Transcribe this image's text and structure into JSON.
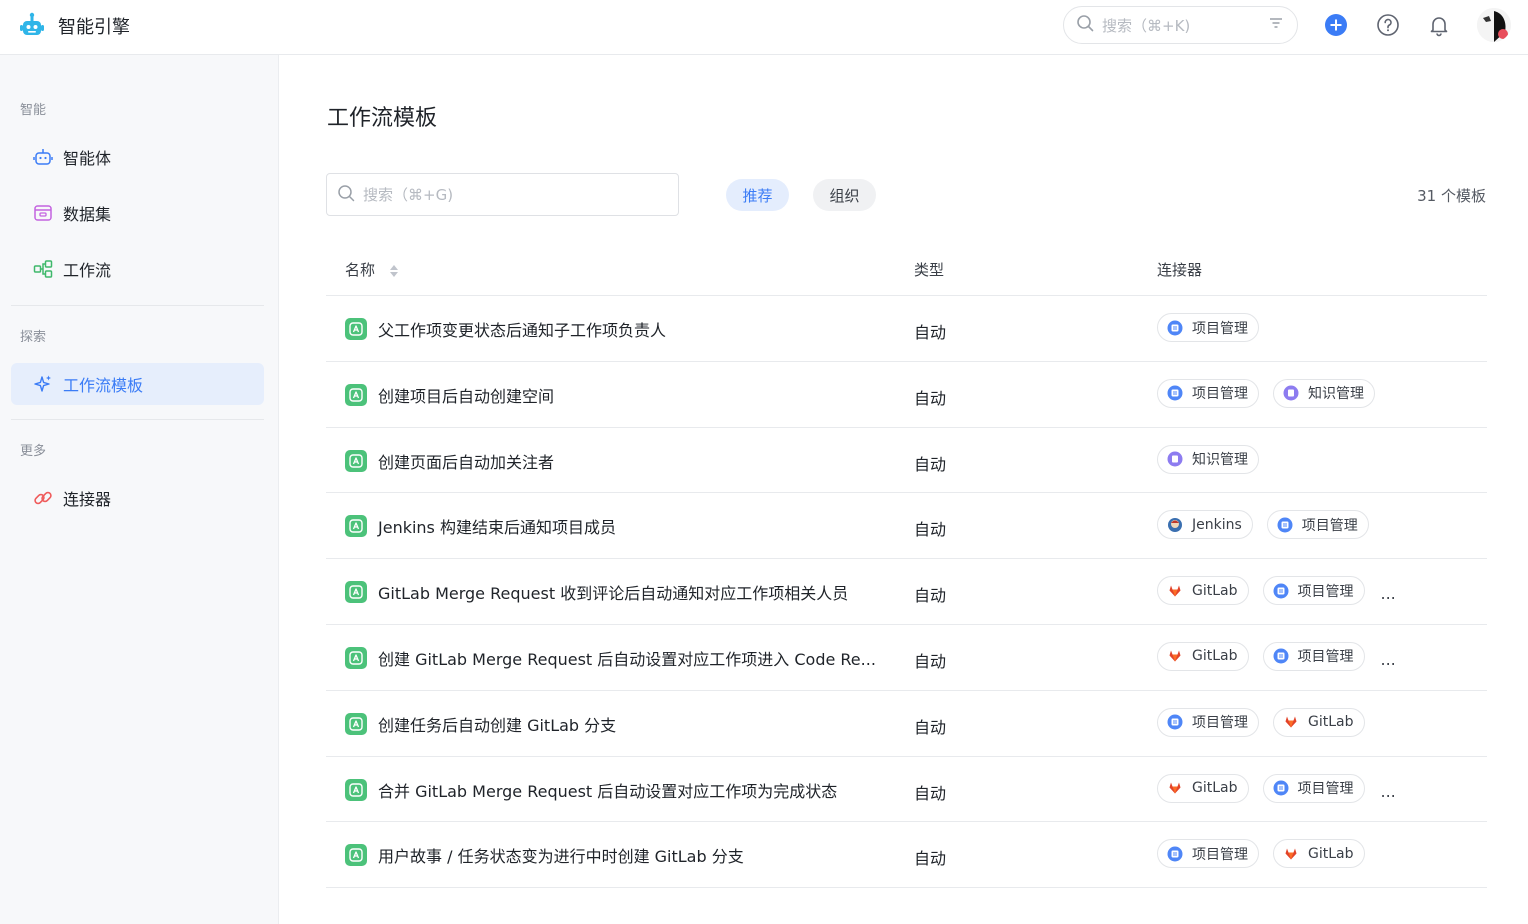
{
  "app": {
    "title": "智能引擎"
  },
  "topbar": {
    "search_placeholder": "搜索（⌘+K)",
    "icons": [
      "filter-icon",
      "plus-circle-icon",
      "help-icon",
      "bell-icon"
    ],
    "accent": "#3b7cf6"
  },
  "sidebar": {
    "sections": [
      {
        "label": "智能",
        "items": [
          {
            "label": "智能体",
            "icon": "robot-icon"
          },
          {
            "label": "数据集",
            "icon": "dataset-icon"
          },
          {
            "label": "工作流",
            "icon": "workflow-icon"
          }
        ]
      },
      {
        "label": "探索",
        "items": [
          {
            "label": "工作流模板",
            "icon": "sparkle-icon",
            "active": true
          }
        ]
      },
      {
        "label": "更多",
        "items": [
          {
            "label": "连接器",
            "icon": "link-icon"
          }
        ]
      }
    ]
  },
  "main": {
    "title": "工作流模板",
    "search_placeholder": "搜索（⌘+G)",
    "filters": [
      {
        "label": "推荐",
        "active": true
      },
      {
        "label": "组织",
        "active": false
      }
    ],
    "count_text": "31 个模板",
    "columns": {
      "name": "名称",
      "type": "类型",
      "connectors": "连接器"
    },
    "rows": [
      {
        "name": "父工作项变更状态后通知子工作项负责人",
        "type": "自动",
        "connectors": [
          "项目管理"
        ],
        "more": ""
      },
      {
        "name": "创建项目后自动创建空间",
        "type": "自动",
        "connectors": [
          "项目管理",
          "知识管理"
        ],
        "more": ""
      },
      {
        "name": "创建页面后自动加关注者",
        "type": "自动",
        "connectors": [
          "知识管理"
        ],
        "more": ""
      },
      {
        "name": "Jenkins 构建结束后通知项目成员",
        "type": "自动",
        "connectors": [
          "Jenkins",
          "项目管理"
        ],
        "more": ""
      },
      {
        "name": "GitLab Merge Request 收到评论后自动通知对应工作项相关人员",
        "type": "自动",
        "connectors": [
          "GitLab",
          "项目管理"
        ],
        "more": "..."
      },
      {
        "name": "创建 GitLab Merge Request 后自动设置对应工作项进入 Code Re...",
        "type": "自动",
        "connectors": [
          "GitLab",
          "项目管理"
        ],
        "more": "..."
      },
      {
        "name": "创建任务后自动创建 GitLab 分支",
        "type": "自动",
        "connectors": [
          "项目管理",
          "GitLab"
        ],
        "more": ""
      },
      {
        "name": "合并 GitLab Merge Request 后自动设置对应工作项为完成状态",
        "type": "自动",
        "connectors": [
          "GitLab",
          "项目管理"
        ],
        "more": "..."
      },
      {
        "name": "用户故事 / 任务状态变为进行中时创建 GitLab 分支",
        "type": "自动",
        "connectors": [
          "项目管理",
          "GitLab"
        ],
        "more": ""
      }
    ]
  }
}
